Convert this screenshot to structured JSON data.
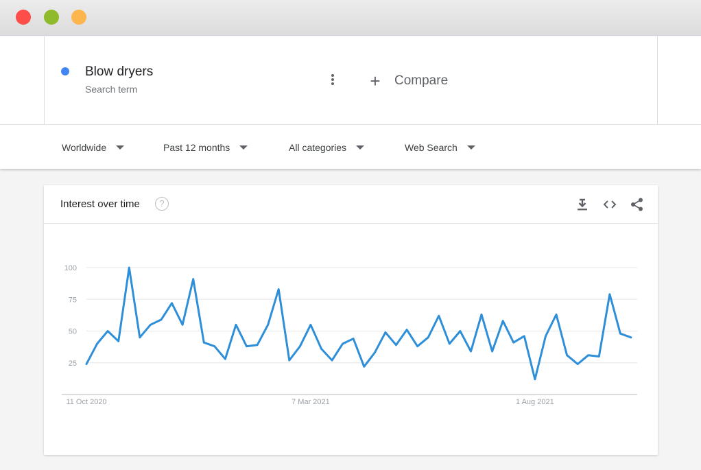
{
  "window": {
    "buttons": [
      "close",
      "minimize",
      "zoom"
    ],
    "colors": {
      "close": "#ff4d4a",
      "minimize": "#8fba2b",
      "zoom": "#fdb54e"
    }
  },
  "term": {
    "name": "Blow dryers",
    "subtitle": "Search term",
    "color": "#4285f4",
    "menu_icon": "more-vert-icon"
  },
  "compare": {
    "label": "Compare",
    "icon": "plus-icon"
  },
  "filters": {
    "region": "Worldwide",
    "time_range": "Past 12 months",
    "category": "All categories",
    "search_type": "Web Search"
  },
  "card": {
    "title": "Interest over time",
    "help_icon": "help-icon",
    "actions": [
      "download-icon",
      "embed-code-icon",
      "share-icon"
    ]
  },
  "chart_data": {
    "type": "line",
    "title": "",
    "xlabel": "",
    "ylabel": "",
    "ylim": [
      0,
      100
    ],
    "yticks": [
      25,
      50,
      75,
      100
    ],
    "x_tick_labels": [
      {
        "index": 0,
        "label": "11 Oct 2020"
      },
      {
        "index": 21,
        "label": "7 Mar 2021"
      },
      {
        "index": 42,
        "label": "1 Aug 2021"
      }
    ],
    "grid": true,
    "line_color": "#2e8fd8",
    "series": [
      {
        "name": "Blow dryers",
        "values": [
          24,
          40,
          50,
          42,
          100,
          45,
          55,
          59,
          72,
          55,
          91,
          41,
          38,
          28,
          55,
          38,
          39,
          55,
          83,
          27,
          38,
          55,
          36,
          27,
          40,
          44,
          22,
          33,
          49,
          39,
          51,
          38,
          45,
          62,
          40,
          50,
          34,
          63,
          34,
          58,
          41,
          46,
          12,
          46,
          63,
          31,
          24,
          31,
          30,
          79,
          48,
          45
        ]
      }
    ]
  }
}
